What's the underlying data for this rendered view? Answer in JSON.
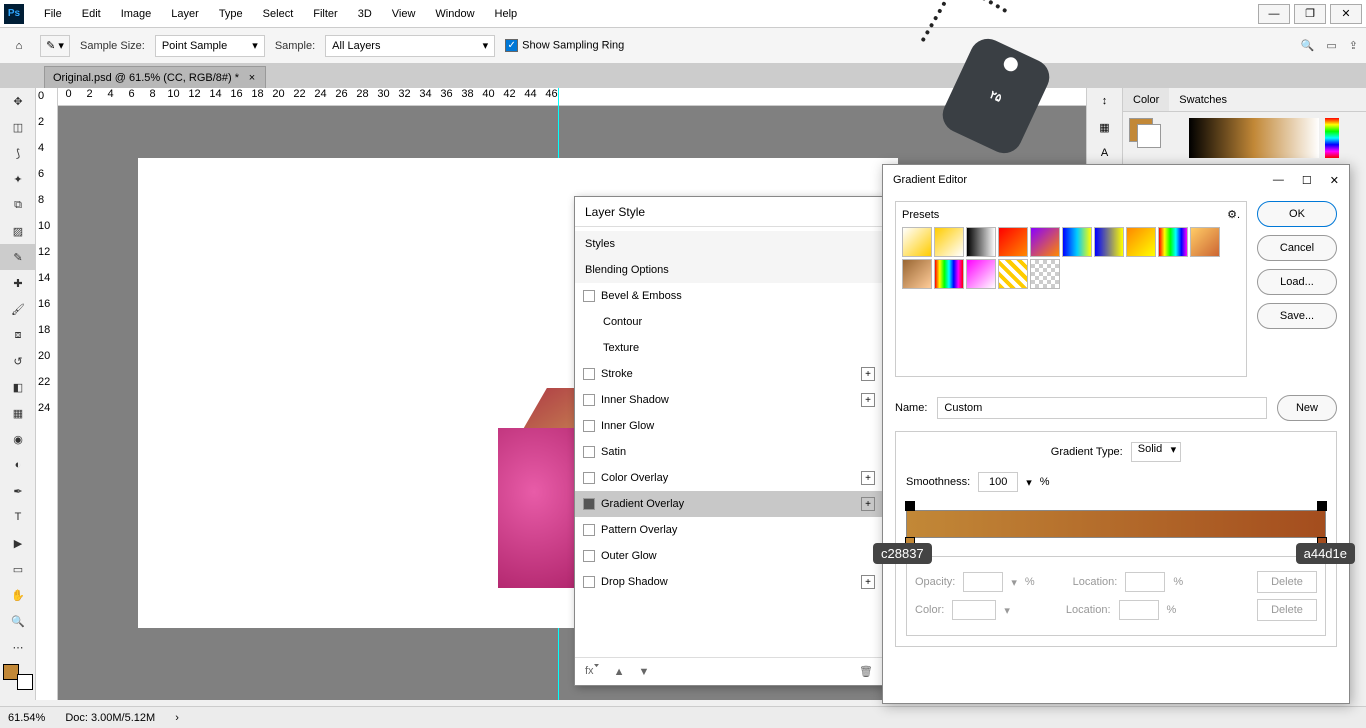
{
  "menubar": [
    "File",
    "Edit",
    "Image",
    "Layer",
    "Type",
    "Select",
    "Filter",
    "3D",
    "View",
    "Window",
    "Help"
  ],
  "optbar": {
    "sample_size_label": "Sample Size:",
    "sample_size_value": "Point Sample",
    "sample_label": "Sample:",
    "sample_value": "All Layers",
    "show_sampling": "Show Sampling Ring"
  },
  "doc_tab": "Original.psd @ 61.5% (CC, RGB/8#) *",
  "ruler_h": [
    0,
    2,
    4,
    6,
    8,
    10,
    12,
    14,
    16,
    18,
    20,
    22,
    24,
    26,
    28,
    30,
    32,
    34,
    36,
    38,
    40,
    42,
    44,
    46
  ],
  "ruler_v": [
    0,
    2,
    4,
    6,
    8,
    10,
    12,
    14,
    16,
    18,
    20,
    22,
    24
  ],
  "status": {
    "zoom": "61.54%",
    "doc": "Doc: 3.00M/5.12M"
  },
  "color_tabs": {
    "color": "Color",
    "swatches": "Swatches"
  },
  "layer_style": {
    "title": "Layer Style",
    "styles": "Styles",
    "blending": "Blending Options",
    "rows": [
      {
        "label": "Bevel & Emboss",
        "chk": true
      },
      {
        "label": "Contour",
        "indent": true
      },
      {
        "label": "Texture",
        "indent": true
      },
      {
        "label": "Stroke",
        "chk": true,
        "plus": true
      },
      {
        "label": "Inner Shadow",
        "chk": true,
        "plus": true
      },
      {
        "label": "Inner Glow",
        "chk": true
      },
      {
        "label": "Satin",
        "chk": true
      },
      {
        "label": "Color Overlay",
        "chk": true,
        "plus": true
      },
      {
        "label": "Gradient Overlay",
        "chk": true,
        "plus": true,
        "on": true,
        "sel": true
      },
      {
        "label": "Pattern Overlay",
        "chk": true
      },
      {
        "label": "Outer Glow",
        "chk": true
      },
      {
        "label": "Drop Shadow",
        "chk": true,
        "plus": true
      }
    ]
  },
  "grad": {
    "title": "Gradient Editor",
    "presets": "Presets",
    "ok": "OK",
    "cancel": "Cancel",
    "load": "Load...",
    "save": "Save...",
    "new": "New",
    "name_label": "Name:",
    "name_value": "Custom",
    "type_label": "Gradient Type:",
    "type_value": "Solid",
    "smooth_label": "Smoothness:",
    "smooth_value": "100",
    "pct": "%",
    "opacity": "Opacity:",
    "location": "Location:",
    "color": "Color:",
    "delete": "Delete",
    "left_hex": "c28837",
    "right_hex": "a44d1e"
  },
  "badge": "۲۵",
  "preset_colors": [
    "linear-gradient(135deg,#fff,#fc0)",
    "linear-gradient(135deg,#fc0,transparent)",
    "linear-gradient(90deg,#000,#fff)",
    "linear-gradient(135deg,red,#f80)",
    "linear-gradient(135deg,#80f,#f80)",
    "linear-gradient(90deg,#00f,#0cf,#ff0)",
    "linear-gradient(90deg,#00f,#ff0)",
    "linear-gradient(135deg,#f80,#ff0)",
    "linear-gradient(90deg,red,yellow,lime,cyan,blue,magenta)",
    "linear-gradient(135deg,#fc6,#c63)",
    "linear-gradient(135deg,#963,#fc9)",
    "linear-gradient(90deg,red,yellow,lime,cyan,blue,magenta,red)",
    "linear-gradient(135deg,#f0f,transparent)",
    "repeating-linear-gradient(45deg,#fc0 0 4px,#fff 4px 8px)",
    "repeating-conic-gradient(#ccc 0 25%,#fff 0 50%)"
  ]
}
